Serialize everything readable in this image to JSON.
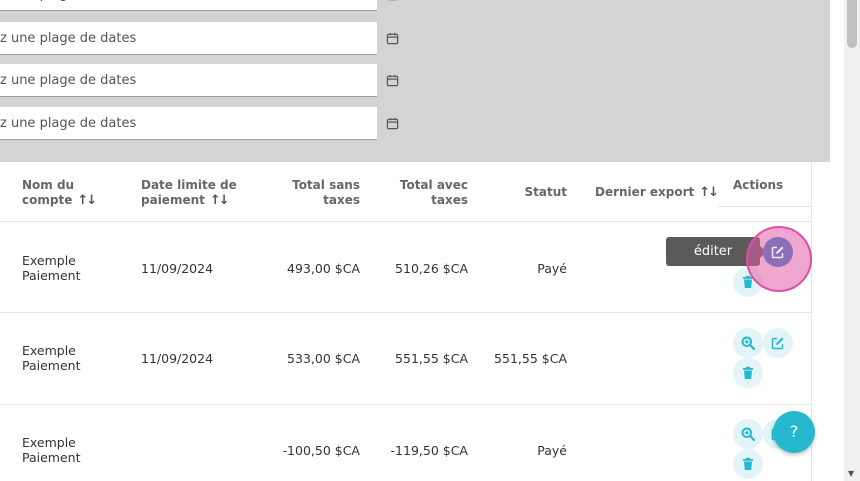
{
  "filters": {
    "date_placeholder": "z une plage de dates"
  },
  "table": {
    "headers": {
      "account": [
        "Nom du",
        "compte"
      ],
      "due_date": [
        "Date limite de",
        "paiement"
      ],
      "total_excl": [
        "Total sans",
        "taxes"
      ],
      "total_incl": [
        "Total avec",
        "taxes"
      ],
      "status": "Statut",
      "last_export": "Dernier export",
      "actions": "Actions"
    },
    "rows": [
      {
        "account": [
          "Exemple",
          "Paiement"
        ],
        "due_date": "11/09/2024",
        "total_excl": "493,00 $CA",
        "total_incl": "510,26 $CA",
        "status": "Payé"
      },
      {
        "account": [
          "Exemple",
          "Paiement"
        ],
        "due_date": "11/09/2024",
        "total_excl": "533,00 $CA",
        "total_incl": "551,55 $CA",
        "status": "551,55 $CA"
      },
      {
        "account": [
          "Exemple",
          "Paiement"
        ],
        "due_date": "",
        "total_excl": "-100,50 $CA",
        "total_incl": "-119,50 $CA",
        "status": "Payé"
      }
    ]
  },
  "tooltip": {
    "text": "éditer"
  },
  "help": {
    "label": "?"
  },
  "icons": {
    "calendar": "calendar-icon",
    "view": "search-plus-icon",
    "edit": "edit-icon",
    "delete": "trash-icon",
    "sort": "sort-icon"
  },
  "colors": {
    "accent": "#26b8cf",
    "action_bg": "#e2f4f6",
    "highlight": "#de4fa6",
    "tooltip_bg": "#5a5a5a",
    "panel_bg": "#d4d4d4"
  }
}
